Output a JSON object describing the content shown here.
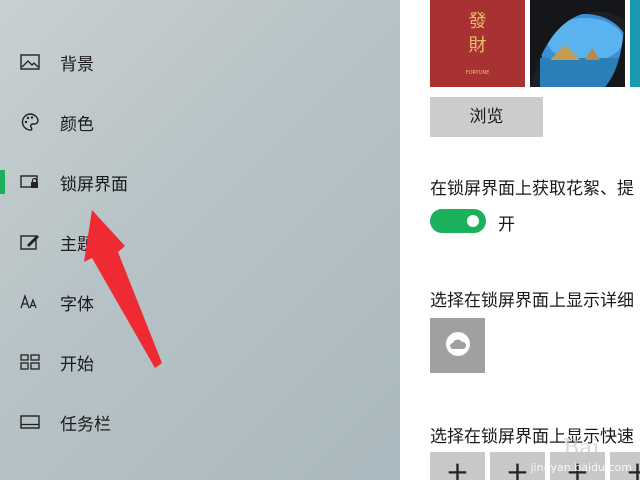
{
  "sidebar": {
    "items": [
      {
        "label": "背景",
        "icon": "image-icon"
      },
      {
        "label": "颜色",
        "icon": "palette-icon"
      },
      {
        "label": "锁屏界面",
        "icon": "lock-screen-icon",
        "active": true
      },
      {
        "label": "主题",
        "icon": "theme-icon"
      },
      {
        "label": "字体",
        "icon": "font-icon"
      },
      {
        "label": "开始",
        "icon": "start-icon"
      },
      {
        "label": "任务栏",
        "icon": "taskbar-icon"
      }
    ],
    "accent_color": "#1bb05a"
  },
  "content": {
    "thumbnail_red_text": "發\n財",
    "thumbnail_red_caption": "FORTUNE",
    "browse_button": "浏览",
    "spotlight_setting": "在锁屏界面上获取花絮、提",
    "toggle_state": "开",
    "detail_setting": "选择在锁屏界面上显示详细",
    "quick_setting": "选择在锁屏界面上显示快速",
    "plus_symbol": "+",
    "toggle_color": "#1bb05a"
  },
  "watermark": {
    "logo": "Bai",
    "text": "jingyan.baidu.com"
  },
  "annotation_color": "#ee2b33"
}
